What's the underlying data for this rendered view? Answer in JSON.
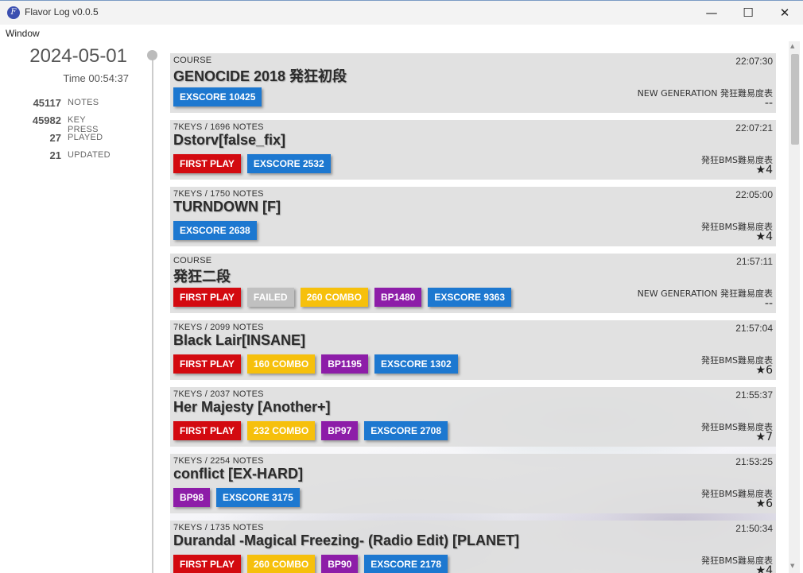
{
  "window": {
    "title": "Flavor Log v0.0.5",
    "icon_letter": "F",
    "minimize": "—",
    "maximize": "☐",
    "close": "✕"
  },
  "menu": {
    "window": "Window"
  },
  "summary": {
    "date": "2024-05-01",
    "time": "Time 00:54:37",
    "stats": [
      {
        "value": "45117",
        "label": "NOTES"
      },
      {
        "value": "45982",
        "label": "KEY PRESS"
      },
      {
        "value": "27",
        "label": "PLAYED"
      },
      {
        "value": "21",
        "label": "UPDATED"
      }
    ]
  },
  "entries": [
    {
      "kind": "COURSE",
      "title": "GENOCIDE 2018 発狂初段",
      "time": "22:07:30",
      "badges": [
        {
          "type": "ex",
          "label": "EXSCORE 10425"
        }
      ],
      "table": "NEW GENERATION 発狂難易度表",
      "level": "--"
    },
    {
      "kind": "7KEYS / 1696 NOTES",
      "title": "Dstorv[false_fix]",
      "time": "22:07:21",
      "badges": [
        {
          "type": "first",
          "label": "FIRST PLAY"
        },
        {
          "type": "ex",
          "label": "EXSCORE 2532"
        }
      ],
      "table": "発狂BMS難易度表",
      "level": "★4"
    },
    {
      "kind": "7KEYS / 1750 NOTES",
      "title": "TURNDOWN [F]",
      "time": "22:05:00",
      "badges": [
        {
          "type": "ex",
          "label": "EXSCORE 2638"
        }
      ],
      "table": "発狂BMS難易度表",
      "level": "★4"
    },
    {
      "kind": "COURSE",
      "title": "発狂二段",
      "time": "21:57:11",
      "badges": [
        {
          "type": "first",
          "label": "FIRST PLAY"
        },
        {
          "type": "failed",
          "label": "FAILED"
        },
        {
          "type": "combo",
          "label": "260 COMBO"
        },
        {
          "type": "bp",
          "label": "BP1480"
        },
        {
          "type": "ex",
          "label": "EXSCORE 9363"
        }
      ],
      "table": "NEW GENERATION 発狂難易度表",
      "level": "--"
    },
    {
      "kind": "7KEYS / 2099 NOTES",
      "title": "Black Lair[INSANE]",
      "time": "21:57:04",
      "badges": [
        {
          "type": "first",
          "label": "FIRST PLAY"
        },
        {
          "type": "combo",
          "label": "160 COMBO"
        },
        {
          "type": "bp",
          "label": "BP1195"
        },
        {
          "type": "ex",
          "label": "EXSCORE 1302"
        }
      ],
      "table": "発狂BMS難易度表",
      "level": "★6"
    },
    {
      "kind": "7KEYS / 2037 NOTES",
      "title": "Her Majesty [Another+]",
      "time": "21:55:37",
      "badges": [
        {
          "type": "first",
          "label": "FIRST PLAY"
        },
        {
          "type": "combo",
          "label": "232 COMBO"
        },
        {
          "type": "bp",
          "label": "BP97"
        },
        {
          "type": "ex",
          "label": "EXSCORE 2708"
        }
      ],
      "table": "発狂BMS難易度表",
      "level": "★7"
    },
    {
      "kind": "7KEYS / 2254 NOTES",
      "title": "conflict [EX-HARD]",
      "time": "21:53:25",
      "badges": [
        {
          "type": "bp",
          "label": "BP98"
        },
        {
          "type": "ex",
          "label": "EXSCORE 3175"
        }
      ],
      "table": "発狂BMS難易度表",
      "level": "★6"
    },
    {
      "kind": "7KEYS / 1735 NOTES",
      "title": "Durandal -Magical Freezing- (Radio Edit) [PLANET]",
      "time": "21:50:34",
      "badges": [
        {
          "type": "first",
          "label": "FIRST PLAY"
        },
        {
          "type": "combo",
          "label": "260 COMBO"
        },
        {
          "type": "bp",
          "label": "BP90"
        },
        {
          "type": "ex",
          "label": "EXSCORE 2178"
        }
      ],
      "table": "発狂BMS難易度表",
      "level": "★4"
    }
  ],
  "colors": {
    "first": "#d30a10",
    "failed": "#c0c0c0",
    "combo": "#f6c00c",
    "bp": "#8d1da8",
    "ex": "#1d78d0"
  }
}
